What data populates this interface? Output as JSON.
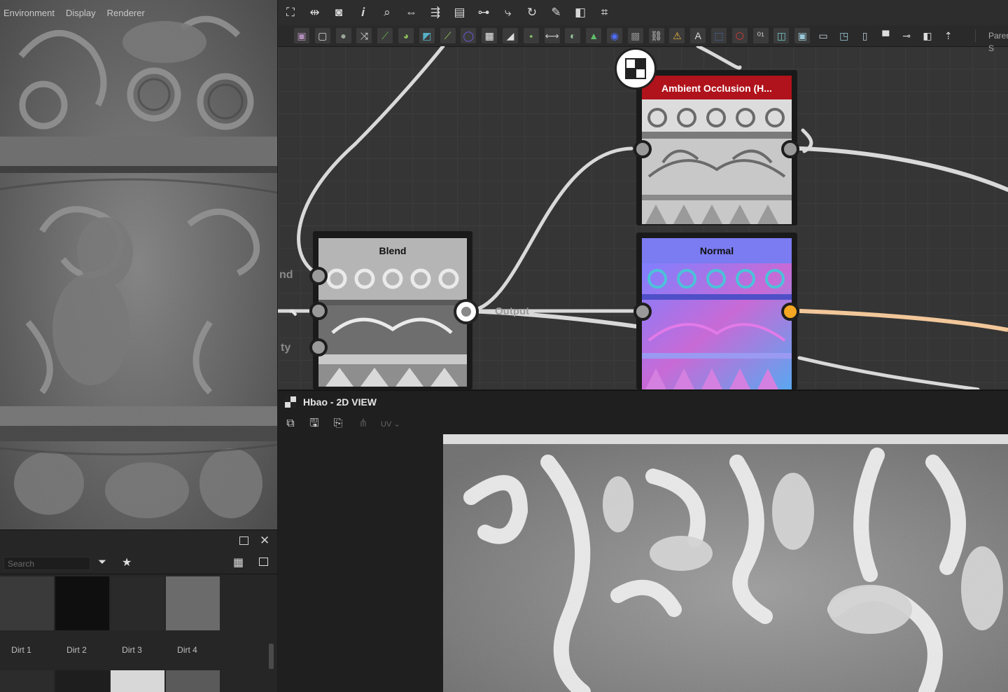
{
  "viewport_menu": [
    "Environment",
    "Display",
    "Renderer"
  ],
  "library": {
    "search_placeholder": "Search",
    "items_row1": [
      {
        "label": "Dirt 1",
        "tone": "#3a3a3a"
      },
      {
        "label": "Dirt 2",
        "tone": "#0f0f0f"
      },
      {
        "label": "Dirt 3",
        "tone": "#2a2a2a"
      },
      {
        "label": "Dirt 4",
        "tone": "#6b6b6b"
      }
    ],
    "items_row2_tones": [
      "#2c2c2c",
      "#1e1e1e",
      "#d8d8d8",
      "#5a5a5a"
    ]
  },
  "graph": {
    "parent_label": "Parent S",
    "nodes": {
      "ao": {
        "title": "Ambient Occlusion (H...",
        "header_color": "#b0131b"
      },
      "blend": {
        "title": "Blend"
      },
      "normal": {
        "title": "Normal",
        "header_color": "#7b7bf2"
      }
    },
    "output_label": "Output",
    "side_labels": [
      "nd",
      "ty"
    ],
    "wire_color_active": "#f2c79a"
  },
  "view2d": {
    "title": "Hbao - 2D VIEW",
    "uv_label": "UV"
  },
  "icons": {
    "toolbar1": [
      "frame-all-icon",
      "fit-icon",
      "camera-icon",
      "info-icon",
      "zoom-icon",
      "align-icon",
      "hierarchy-icon",
      "panel-icon",
      "connect-icon",
      "path-icon",
      "refresh-icon",
      "wrench-icon",
      "preview-icon",
      "crop-icon"
    ],
    "toolbar2_colors": [
      "#b08db9",
      "#d8d8d8",
      "#9aa89a",
      "#ddd",
      "#6ac04f",
      "#8cbf5a",
      "#55b2c7",
      "#9bd35a",
      "#6b5be0",
      "#eee",
      "#ddd",
      "#86c06a",
      "#c0c0c0",
      "#9bc9a0",
      "#5fbf6b",
      "#4f6cf5",
      "#888",
      "#ccc",
      "#e5b23a",
      "#ddd",
      "#4f7ae0",
      "#e03a3a",
      "#ccc",
      "#74c3c6",
      "#9ac9d9",
      "#cbd4dc",
      "#9ac9d9",
      "#bcd",
      "#ddd",
      "#ddd",
      "#ddd",
      "#ddd"
    ]
  }
}
